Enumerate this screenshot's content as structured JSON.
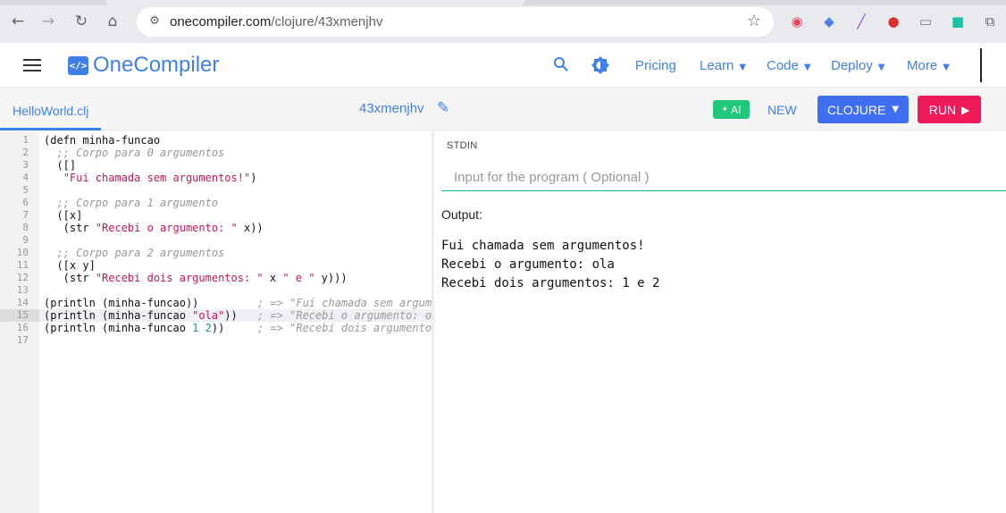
{
  "browser": {
    "url_host": "onecompiler.com",
    "url_path": "/clojure/43xmenjhv",
    "icons": {
      "back": "arrow-left-icon",
      "forward": "arrow-right-icon",
      "reload": "reload-icon",
      "home": "home-icon",
      "site_info": "tune-icon",
      "bookmark": "star-icon"
    },
    "extensions": [
      {
        "name": "pocket-icon",
        "glyph": "◉",
        "color": "#ef4056"
      },
      {
        "name": "blue-diamond-icon",
        "glyph": "◆",
        "color": "#4d7ee8"
      },
      {
        "name": "feather-icon",
        "glyph": "╱",
        "color": "#8e4fd8"
      },
      {
        "name": "red-apple-icon",
        "glyph": "●",
        "color": "#d9302b"
      },
      {
        "name": "reader-icon",
        "glyph": "▭",
        "color": "#7a7f86"
      },
      {
        "name": "green-app-icon",
        "glyph": "■",
        "color": "#17c3a5"
      },
      {
        "name": "puzzle-icon",
        "glyph": "⧉",
        "color": "#5f6368"
      }
    ]
  },
  "header": {
    "logo_mark": "</>",
    "brand": "OneCompiler",
    "nav": {
      "pricing": "Pricing",
      "learn": "Learn",
      "code": "Code",
      "deploy": "Deploy",
      "more": "More"
    },
    "icons": {
      "menu": "hamburger-menu-icon",
      "search": "search-icon",
      "theme": "theme-toggle-icon"
    }
  },
  "toolbar": {
    "file_tab": "HelloWorld.clj",
    "code_id": "43xmenjhv",
    "ai_label": "AI",
    "new_label": "NEW",
    "language_label": "CLOJURE",
    "run_label": "RUN"
  },
  "editor": {
    "active_line": 15,
    "lines": [
      {
        "n": "1",
        "code": "(defn minha-funcao",
        "comment": ""
      },
      {
        "n": "2",
        "code": "  ;; Corpo para 0 argumentos",
        "comment": ""
      },
      {
        "n": "3",
        "code": "  ([]",
        "comment": ""
      },
      {
        "n": "4",
        "code": "   \"Fui chamada sem argumentos!\")",
        "comment": ""
      },
      {
        "n": "5",
        "code": "",
        "comment": ""
      },
      {
        "n": "6",
        "code": "  ;; Corpo para 1 argumento",
        "comment": ""
      },
      {
        "n": "7",
        "code": "  ([x]",
        "comment": ""
      },
      {
        "n": "8",
        "code": "   (str \"Recebi o argumento: \" x))",
        "comment": ""
      },
      {
        "n": "9",
        "code": "",
        "comment": ""
      },
      {
        "n": "10",
        "code": "  ;; Corpo para 2 argumentos",
        "comment": ""
      },
      {
        "n": "11",
        "code": "  ([x y]",
        "comment": ""
      },
      {
        "n": "12",
        "code": "   (str \"Recebi dois argumentos: \" x \" e \" y)))",
        "comment": ""
      },
      {
        "n": "13",
        "code": "",
        "comment": ""
      },
      {
        "n": "14",
        "code": "(println (minha-funcao))",
        "comment": "; => \"Fui chamada sem argume"
      },
      {
        "n": "15",
        "code": "(println (minha-funcao \"ola\"))",
        "comment": "; => \"Recebi o argumento: ol"
      },
      {
        "n": "16",
        "code": "(println (minha-funcao 1 2))",
        "comment": "; => \"Recebi dois argumentos"
      },
      {
        "n": "17",
        "code": "",
        "comment": ""
      }
    ]
  },
  "stdin": {
    "label": "STDIN",
    "placeholder": "Input for the program ( Optional )",
    "value": ""
  },
  "output": {
    "label": "Output:",
    "lines": [
      "Fui chamada sem argumentos!",
      "Recebi o argumento: ola",
      "Recebi dois argumentos: 1 e 2"
    ]
  }
}
